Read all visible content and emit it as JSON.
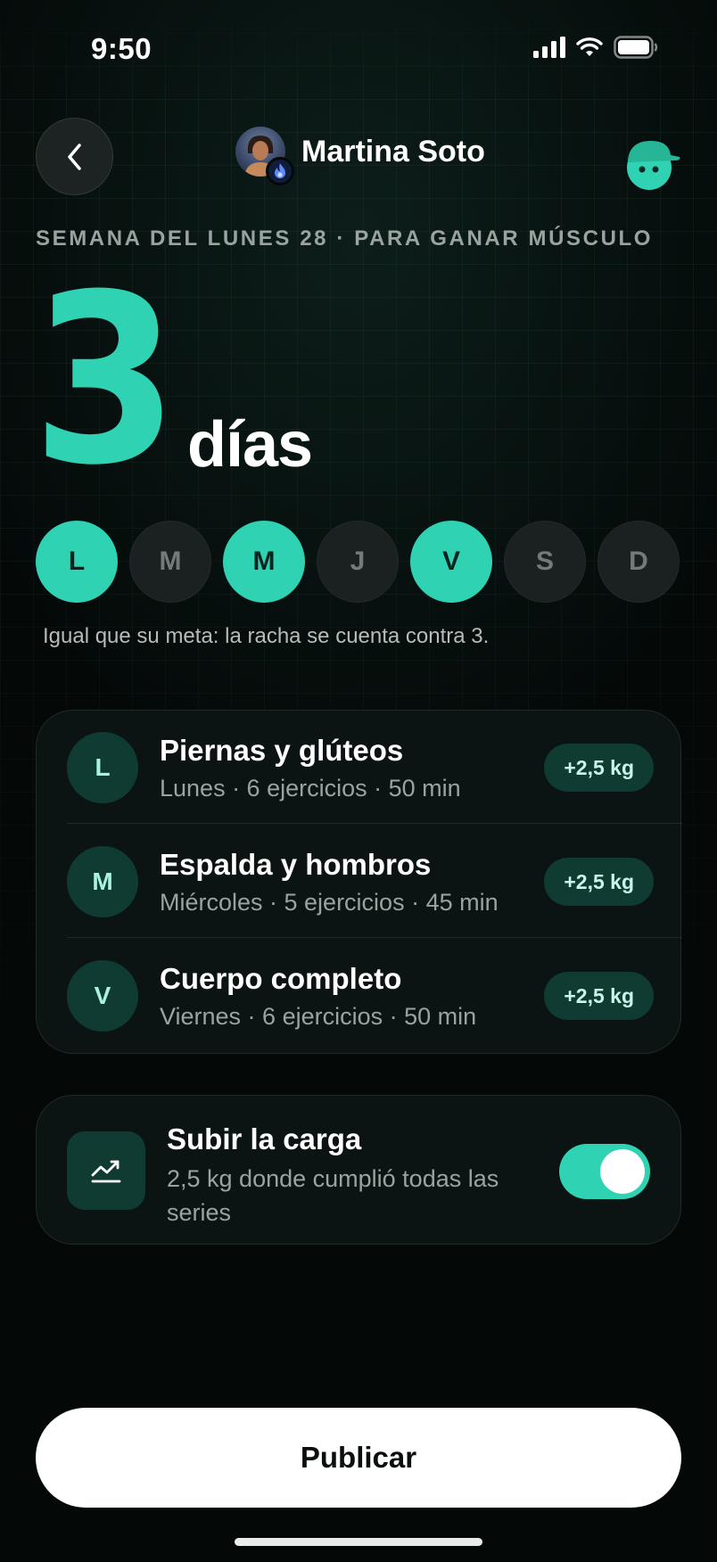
{
  "status_bar": {
    "time": "9:50"
  },
  "header": {
    "name": "Martina Soto"
  },
  "week_label": "SEMANA DEL LUNES 28 · PARA GANAR MÚSCULO",
  "goal": {
    "number": "3",
    "unit": "días"
  },
  "days": [
    {
      "label": "L",
      "active": true
    },
    {
      "label": "M",
      "active": false
    },
    {
      "label": "M",
      "active": true
    },
    {
      "label": "J",
      "active": false
    },
    {
      "label": "V",
      "active": true
    },
    {
      "label": "S",
      "active": false
    },
    {
      "label": "D",
      "active": false
    }
  ],
  "days_note": "Igual que su meta: la racha se cuenta contra 3.",
  "workouts": [
    {
      "badge": "L",
      "title": "Piernas y glúteos",
      "subtitle": "Lunes · 6 ejercicios · 50 min",
      "increment": "+2,5 kg"
    },
    {
      "badge": "M",
      "title": "Espalda y hombros",
      "subtitle": "Miércoles · 5 ejercicios · 45 min",
      "increment": "+2,5 kg"
    },
    {
      "badge": "V",
      "title": "Cuerpo completo",
      "subtitle": "Viernes · 6 ejercicios · 50 min",
      "increment": "+2,5 kg"
    }
  ],
  "load_card": {
    "title": "Subir la carga",
    "subtitle": "2,5 kg donde cumplió todas las series",
    "enabled": true,
    "icon": "trending-up-icon"
  },
  "publish_label": "Publicar",
  "colors": {
    "accent": "#2fd2b2",
    "badge_bg": "#0f3b33",
    "background": "#040908"
  }
}
